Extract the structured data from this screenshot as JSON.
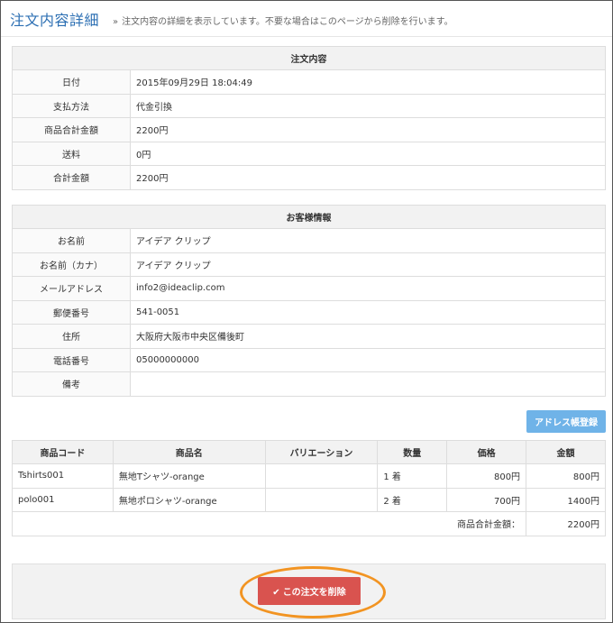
{
  "page": {
    "title": "注文内容詳細",
    "subtitle_icon": "»",
    "subtitle": "注文内容の詳細を表示しています。不要な場合はこのページから削除を行います。"
  },
  "order": {
    "heading": "注文内容",
    "rows": [
      {
        "label": "日付",
        "value": "2015年09月29日 18:04:49"
      },
      {
        "label": "支払方法",
        "value": "代金引換"
      },
      {
        "label": "商品合計金額",
        "value": "2200円"
      },
      {
        "label": "送料",
        "value": "0円"
      },
      {
        "label": "合計金額",
        "value": "2200円"
      }
    ]
  },
  "customer": {
    "heading": "お客様情報",
    "rows": [
      {
        "label": "お名前",
        "value": "アイデア クリップ"
      },
      {
        "label": "お名前（カナ）",
        "value": "アイデア クリップ"
      },
      {
        "label": "メールアドレス",
        "value": "info2@ideaclip.com"
      },
      {
        "label": "郵便番号",
        "value": "541-0051"
      },
      {
        "label": "住所",
        "value": "大阪府大阪市中央区備後町"
      },
      {
        "label": "電話番号",
        "value": "05000000000"
      },
      {
        "label": "備考",
        "value": ""
      }
    ]
  },
  "address_book_button": "アドレス帳登録",
  "items": {
    "headers": [
      "商品コード",
      "商品名",
      "バリエーション",
      "数量",
      "価格",
      "金額"
    ],
    "rows": [
      {
        "code": "Tshirts001",
        "name": "無地Tシャツ-orange",
        "variation": "",
        "qty": "1 着",
        "price": "800円",
        "amount": "800円"
      },
      {
        "code": "polo001",
        "name": "無地ポロシャツ-orange",
        "variation": "",
        "qty": "2 着",
        "price": "700円",
        "amount": "1400円"
      }
    ],
    "total_label": "商品合計金額：",
    "total_value": "2200円"
  },
  "delete_button": {
    "icon": "✔",
    "label": "この注文を削除"
  },
  "colors": {
    "title": "#2c6fb3",
    "address_button": "#6fb3e8",
    "delete_button": "#d9534f",
    "highlight_ring": "#f29422"
  }
}
